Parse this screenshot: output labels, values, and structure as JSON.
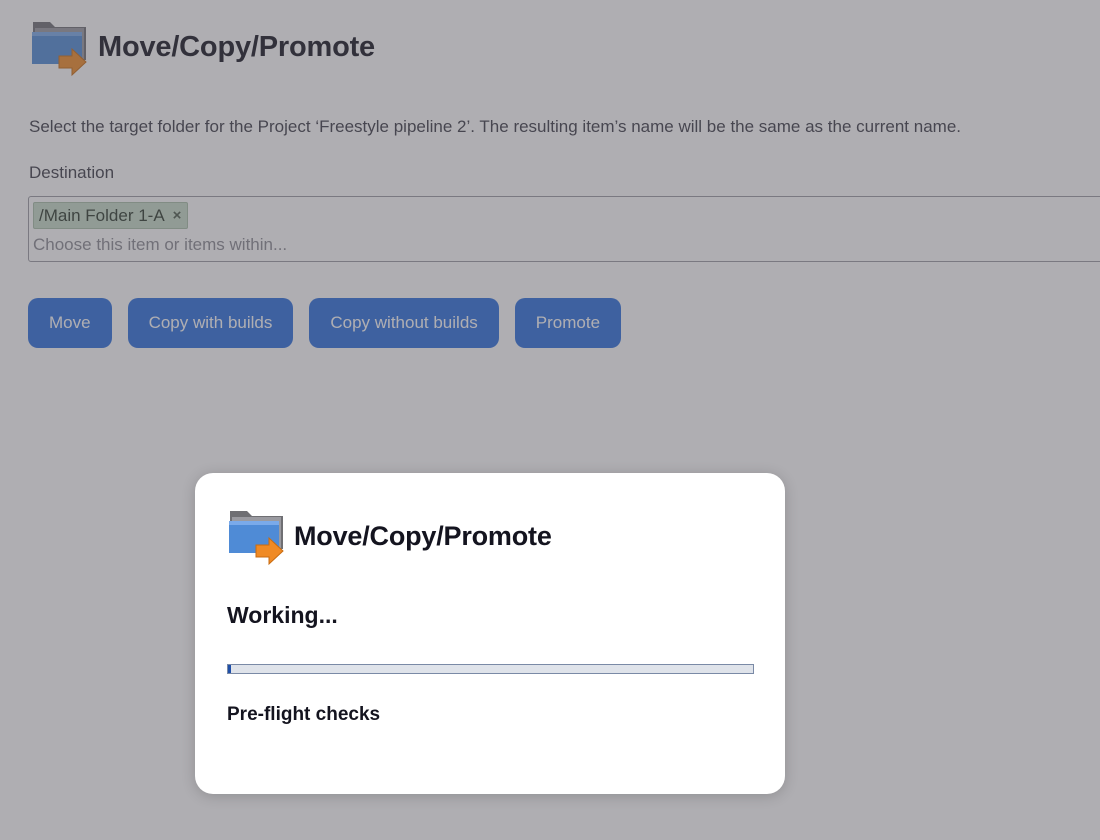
{
  "page": {
    "title": "Move/Copy/Promote",
    "description": "Select the target folder for the Project ‘Freestyle pipeline 2’. The resulting item’s name will be the same as the current name.",
    "destination_label": "Destination",
    "destination": {
      "selected_tag": "/Main Folder 1-A",
      "remove_tag_glyph": "×",
      "placeholder": "Choose this item or items within..."
    },
    "buttons": {
      "move": "Move",
      "copy_with_builds": "Copy with builds",
      "copy_without_builds": "Copy without builds",
      "promote": "Promote"
    }
  },
  "dialog": {
    "title": "Move/Copy/Promote",
    "status": "Working...",
    "progress_fraction": 0.005,
    "step": "Pre-flight checks"
  },
  "icons": {
    "header": "folder-move-icon",
    "dialog": "folder-move-icon"
  },
  "colors": {
    "button_blue": "#2b6fde",
    "tag_green": "#c7dbc8",
    "progress_fill": "#1f4fa8",
    "overlay": "rgba(84,82,92,0.47)"
  }
}
